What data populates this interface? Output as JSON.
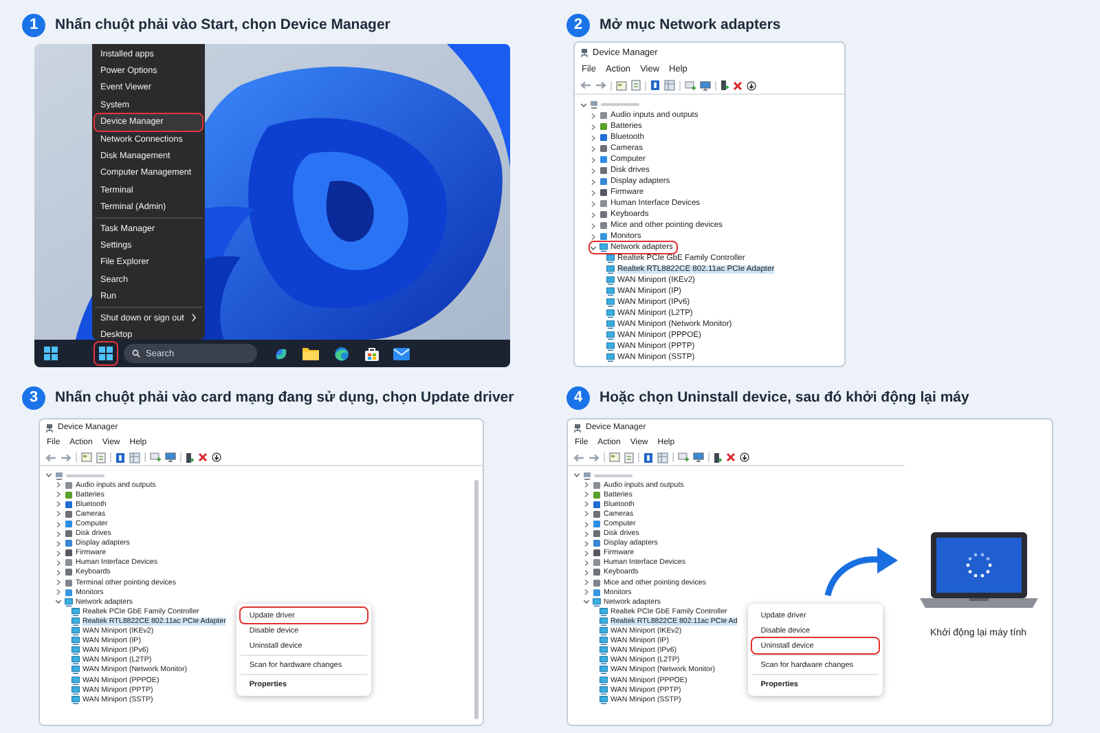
{
  "steps": [
    {
      "number": "1",
      "title": "Nhấn chuột phải vào Start, chọn Device Manager",
      "kind": "desktop",
      "context_menu": {
        "groups": [
          [
            {
              "label": "Installed apps",
              "highlighted": false,
              "submenu": false
            },
            {
              "label": "Power Options",
              "highlighted": false,
              "submenu": false
            },
            {
              "label": "Event Viewer",
              "highlighted": false,
              "submenu": false
            },
            {
              "label": "System",
              "highlighted": false,
              "submenu": false
            },
            {
              "label": "Device Manager",
              "highlighted": true,
              "submenu": false
            },
            {
              "label": "Network Connections",
              "highlighted": false,
              "submenu": false
            },
            {
              "label": "Disk Management",
              "highlighted": false,
              "submenu": false
            },
            {
              "label": "Computer Management",
              "highlighted": false,
              "submenu": false
            },
            {
              "label": "Terminal",
              "highlighted": false,
              "submenu": false
            },
            {
              "label": "Terminal (Admin)",
              "highlighted": false,
              "submenu": false
            }
          ],
          [
            {
              "label": "Task Manager",
              "highlighted": false,
              "submenu": false
            },
            {
              "label": "Settings",
              "highlighted": false,
              "submenu": false
            },
            {
              "label": "File Explorer",
              "highlighted": false,
              "submenu": false
            },
            {
              "label": "Search",
              "highlighted": false,
              "submenu": false
            },
            {
              "label": "Run",
              "highlighted": false,
              "submenu": false
            }
          ],
          [
            {
              "label": "Shut down or sign out",
              "highlighted": false,
              "submenu": true
            },
            {
              "label": "Desktop",
              "highlighted": false,
              "submenu": false
            }
          ]
        ]
      },
      "taskbar": {
        "items": [
          {
            "kind": "windows",
            "highlighted": false
          },
          {
            "kind": "windows",
            "highlighted": true
          },
          {
            "kind": "search",
            "placeholder": "Search",
            "highlighted": false
          },
          {
            "kind": "copilot",
            "highlighted": false
          },
          {
            "kind": "folder",
            "highlighted": false
          },
          {
            "kind": "edge",
            "highlighted": false
          },
          {
            "kind": "store",
            "highlighted": false
          },
          {
            "kind": "mail",
            "highlighted": false
          }
        ]
      }
    },
    {
      "number": "2",
      "title": "Mở mục Network adapters",
      "kind": "tree",
      "window": {
        "title": "Device Manager",
        "menu": [
          "File",
          "Action",
          "View",
          "Help"
        ],
        "categories": [
          {
            "label": "Audio inputs and outputs",
            "expanded": false,
            "highlighted": false
          },
          {
            "label": "Batteries",
            "expanded": false,
            "highlighted": false
          },
          {
            "label": "Bluetooth",
            "expanded": false,
            "highlighted": false
          },
          {
            "label": "Cameras",
            "expanded": false,
            "highlighted": false
          },
          {
            "label": "Computer",
            "expanded": false,
            "highlighted": false
          },
          {
            "label": "Disk drives",
            "expanded": false,
            "highlighted": false
          },
          {
            "label": "Display adapters",
            "expanded": false,
            "highlighted": false
          },
          {
            "label": "Firmware",
            "expanded": false,
            "highlighted": false
          },
          {
            "label": "Human Interface Devices",
            "expanded": false,
            "highlighted": false
          },
          {
            "label": "Keyboards",
            "expanded": false,
            "highlighted": false
          },
          {
            "label": "Mice and other pointing devices",
            "expanded": false,
            "highlighted": false
          },
          {
            "label": "Monitors",
            "expanded": false,
            "highlighted": false
          },
          {
            "label": "Network adapters",
            "expanded": true,
            "highlighted": true,
            "children": [
              {
                "label": "Realtek PCIe GbE Family Controller",
                "selected": false
              },
              {
                "label": "Realtek RTL8822CE 802.11ac PCIe Adapter",
                "selected": true
              },
              {
                "label": "WAN Miniport (IKEv2)",
                "selected": false
              },
              {
                "label": "WAN Miniport (IP)",
                "selected": false
              },
              {
                "label": "WAN Miniport (IPv6)",
                "selected": false
              },
              {
                "label": "WAN Miniport (L2TP)",
                "selected": false
              },
              {
                "label": "WAN Miniport (Network Monitor)",
                "selected": false
              },
              {
                "label": "WAN Miniport (PPPOE)",
                "selected": false
              },
              {
                "label": "WAN Miniport (PPTP)",
                "selected": false
              },
              {
                "label": "WAN Miniport (SSTP)",
                "selected": false
              }
            ]
          }
        ]
      }
    },
    {
      "number": "3",
      "title": "Nhấn chuột phải vào card mạng đang sử dụng, chọn Update driver",
      "kind": "context-menu",
      "window": {
        "title": "Device Manager",
        "menu": [
          "File",
          "Action",
          "View",
          "Help"
        ],
        "categories": [
          {
            "label": "Audio inputs and outputs",
            "expanded": false,
            "highlighted": false
          },
          {
            "label": "Batteries",
            "expanded": false,
            "highlighted": false
          },
          {
            "label": "Bluetooth",
            "expanded": false,
            "highlighted": false
          },
          {
            "label": "Cameras",
            "expanded": false,
            "highlighted": false
          },
          {
            "label": "Computer",
            "expanded": false,
            "highlighted": false
          },
          {
            "label": "Disk drives",
            "expanded": false,
            "highlighted": false
          },
          {
            "label": "Display adapters",
            "expanded": false,
            "highlighted": false
          },
          {
            "label": "Firmware",
            "expanded": false,
            "highlighted": false
          },
          {
            "label": "Human Interface Devices",
            "expanded": false,
            "highlighted": false
          },
          {
            "label": "Keyboards",
            "expanded": false,
            "highlighted": false
          },
          {
            "label": "Terminal other pointing devices",
            "expanded": false,
            "highlighted": false
          },
          {
            "label": "Monitors",
            "expanded": false,
            "highlighted": false
          },
          {
            "label": "Network adapters",
            "expanded": true,
            "highlighted": false,
            "children": [
              {
                "label": "Realtek PCIe GbE Family Controller",
                "selected": false
              },
              {
                "label": "Realtek RTL8822CE 802.11ac PCIe Adapter",
                "selected": true
              },
              {
                "label": "WAN Miniport (IKEv2)",
                "selected": false
              },
              {
                "label": "WAN Miniport (IP)",
                "selected": false
              },
              {
                "label": "WAN Miniport (IPv6)",
                "selected": false
              },
              {
                "label": "WAN Miniport (L2TP)",
                "selected": false
              },
              {
                "label": "WAN Miniport (Network Monitor)",
                "selected": false
              },
              {
                "label": "WAN Miniport (PPPOE)",
                "selected": false
              },
              {
                "label": "WAN Miniport (PPTP)",
                "selected": false
              },
              {
                "label": "WAN Miniport (SSTP)",
                "selected": false
              }
            ]
          }
        ],
        "context_menu": {
          "groups": [
            [
              {
                "label": "Update driver",
                "highlighted": true,
                "bold": false
              },
              {
                "label": "Disable device",
                "highlighted": false,
                "bold": false
              },
              {
                "label": "Uninstall device",
                "highlighted": false,
                "bold": false
              }
            ],
            [
              {
                "label": "Scan for hardware changes",
                "highlighted": false,
                "bold": false
              }
            ],
            [
              {
                "label": "Properties",
                "highlighted": false,
                "bold": true
              }
            ]
          ]
        }
      }
    },
    {
      "number": "4",
      "title": "Hoặc chọn Uninstall device, sau đó khởi động lại máy",
      "kind": "restart",
      "window": {
        "title": "Device Manager",
        "menu": [
          "File",
          "Action",
          "View",
          "Help"
        ],
        "categories": [
          {
            "label": "Audio inputs and outputs",
            "expanded": false,
            "highlighted": false
          },
          {
            "label": "Batteries",
            "expanded": false,
            "highlighted": false
          },
          {
            "label": "Bluetooth",
            "expanded": false,
            "highlighted": false
          },
          {
            "label": "Cameras",
            "expanded": false,
            "highlighted": false
          },
          {
            "label": "Computer",
            "expanded": false,
            "highlighted": false
          },
          {
            "label": "Disk drives",
            "expanded": false,
            "highlighted": false
          },
          {
            "label": "Display adapters",
            "expanded": false,
            "highlighted": false
          },
          {
            "label": "Firmware",
            "expanded": false,
            "highlighted": false
          },
          {
            "label": "Human Interface Devices",
            "expanded": false,
            "highlighted": false
          },
          {
            "label": "Keyboards",
            "expanded": false,
            "highlighted": false
          },
          {
            "label": "Mice and other pointing devices",
            "expanded": false,
            "highlighted": false
          },
          {
            "label": "Monitors",
            "expanded": false,
            "highlighted": false
          },
          {
            "label": "Network adapters",
            "expanded": true,
            "highlighted": false,
            "children": [
              {
                "label": "Realtek PCIe GbE Family Controller",
                "selected": false
              },
              {
                "label": "Realtek RTL8822CE 802.11ac PCIe Ad",
                "selected": true
              },
              {
                "label": "WAN Miniport (IKEv2)",
                "selected": false
              },
              {
                "label": "WAN Miniport (IP)",
                "selected": false
              },
              {
                "label": "WAN Miniport (IPv6)",
                "selected": false
              },
              {
                "label": "WAN Miniport (L2TP)",
                "selected": false
              },
              {
                "label": "WAN Miniport (Network Monitor)",
                "selected": false
              },
              {
                "label": "WAN Miniport (PPPOE)",
                "selected": false
              },
              {
                "label": "WAN Miniport (PPTP)",
                "selected": false
              },
              {
                "label": "WAN Miniport (SSTP)",
                "selected": false
              }
            ]
          }
        ],
        "context_menu": {
          "groups": [
            [
              {
                "label": "Update driver",
                "highlighted": false,
                "bold": false
              },
              {
                "label": "Disable device",
                "highlighted": false,
                "bold": false
              },
              {
                "label": "Uninstall device",
                "highlighted": true,
                "bold": false
              }
            ],
            [
              {
                "label": "Scan for hardware changes",
                "highlighted": false,
                "bold": false
              }
            ],
            [
              {
                "label": "Properties",
                "highlighted": false,
                "bold": true
              }
            ]
          ]
        }
      },
      "restart": {
        "caption": "Khởi động lại máy tính"
      }
    }
  ]
}
